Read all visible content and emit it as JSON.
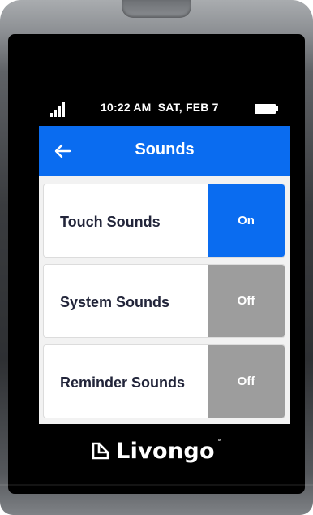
{
  "status": {
    "time": "10:22 AM",
    "date": "SAT, FEB 7",
    "signal_icon": "signal-bars-icon",
    "battery_icon": "battery-full-icon"
  },
  "header": {
    "title": "Sounds",
    "back_icon": "arrow-left-icon",
    "background_color": "#0a6cf0"
  },
  "settings": [
    {
      "label": "Touch Sounds",
      "state": "On",
      "enabled": true
    },
    {
      "label": "System Sounds",
      "state": "Off",
      "enabled": false
    },
    {
      "label": "Reminder Sounds",
      "state": "Off",
      "enabled": false
    }
  ],
  "colors": {
    "toggle_on": "#0a6cf0",
    "toggle_off": "#9d9d9d",
    "label_text": "#22253a"
  },
  "brand": {
    "name": "Livongo",
    "trademark": "™"
  }
}
